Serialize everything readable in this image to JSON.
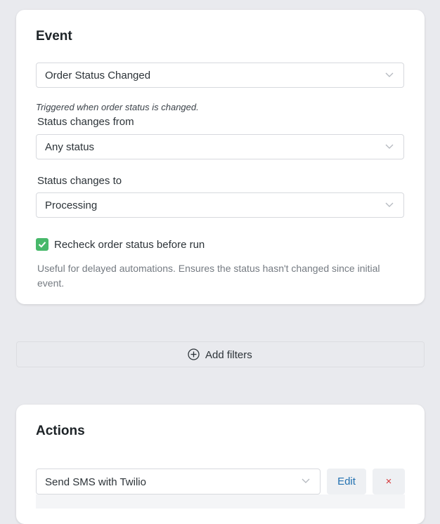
{
  "event": {
    "title": "Event",
    "trigger_select": "Order Status Changed",
    "trigger_hint": "Triggered when order status is changed.",
    "from_label": "Status changes from",
    "from_select": "Any status",
    "to_label": "Status changes to",
    "to_select": "Processing",
    "recheck_label": "Recheck order status before run",
    "recheck_checked": true,
    "recheck_description": "Useful for delayed automations. Ensures the status hasn't changed since initial event."
  },
  "filters": {
    "add_label": "Add filters"
  },
  "actions": {
    "title": "Actions",
    "action_select": "Send SMS with Twilio",
    "edit_label": "Edit",
    "delete_label": "×"
  },
  "colors": {
    "background": "#e9eaee",
    "card": "#ffffff",
    "checkbox": "#47b86a",
    "link": "#2271b1",
    "danger": "#d63638"
  }
}
